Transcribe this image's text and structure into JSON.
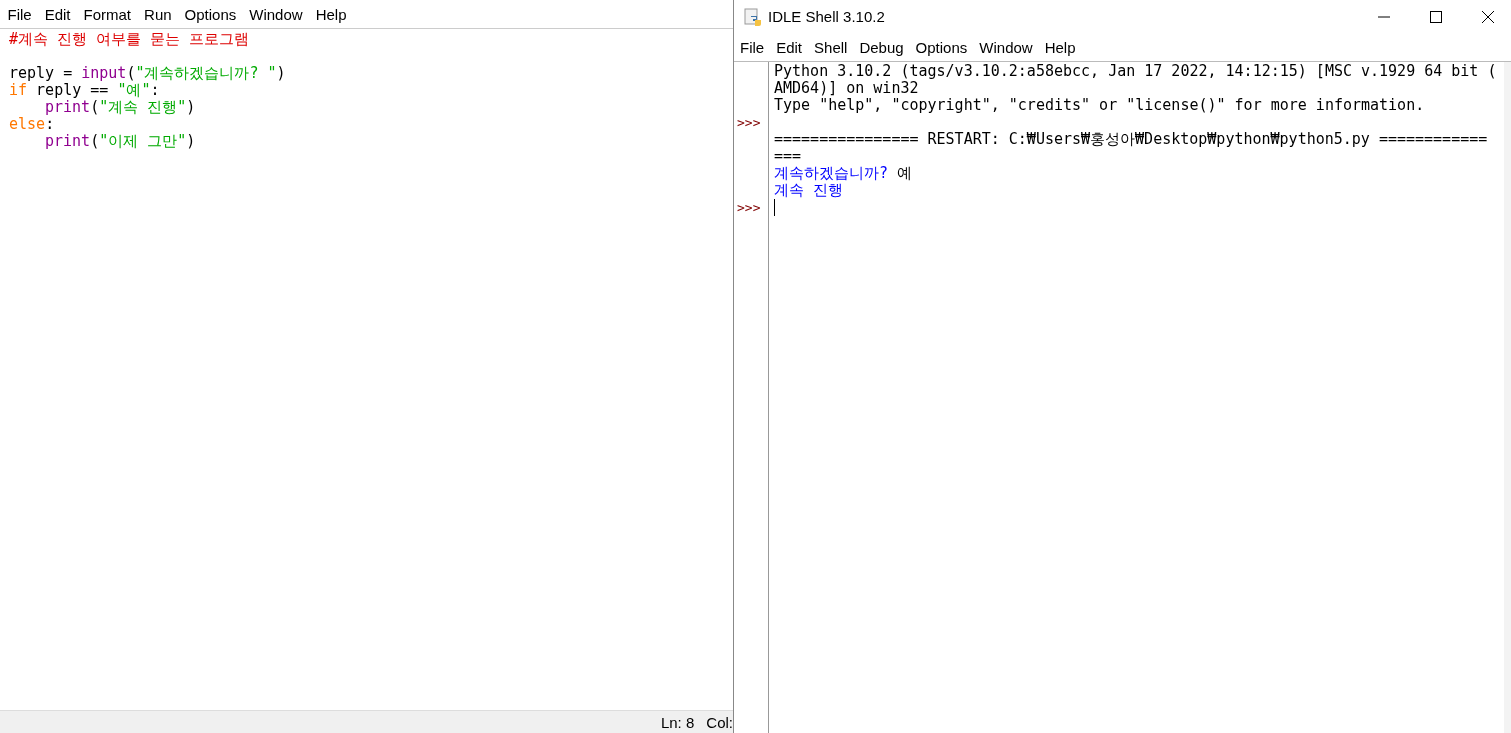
{
  "editor": {
    "menu": [
      "File",
      "Edit",
      "Format",
      "Run",
      "Options",
      "Window",
      "Help"
    ],
    "code_lines": [
      {
        "tokens": [
          {
            "kind": "comment",
            "text": "#계속 진행 여부를 묻는 프로그램"
          }
        ]
      },
      {
        "blank_before": true,
        "tokens": [
          {
            "kind": "plain",
            "text": "reply = "
          },
          {
            "kind": "builtin",
            "text": "input"
          },
          {
            "kind": "plain",
            "text": "("
          },
          {
            "kind": "string",
            "text": "\"계속하겠습니까? \""
          },
          {
            "kind": "plain",
            "text": ")"
          }
        ]
      },
      {
        "tokens": [
          {
            "kind": "keyword",
            "text": "if"
          },
          {
            "kind": "plain",
            "text": " reply == "
          },
          {
            "kind": "string",
            "text": "\"예\""
          },
          {
            "kind": "plain",
            "text": ":"
          }
        ]
      },
      {
        "indent": true,
        "tokens": [
          {
            "kind": "builtin",
            "text": "print"
          },
          {
            "kind": "plain",
            "text": "("
          },
          {
            "kind": "string",
            "text": "\"계속 진행\""
          },
          {
            "kind": "plain",
            "text": ")"
          }
        ]
      },
      {
        "tokens": [
          {
            "kind": "keyword",
            "text": "else"
          },
          {
            "kind": "plain",
            "text": ":"
          }
        ]
      },
      {
        "indent": true,
        "tokens": [
          {
            "kind": "builtin",
            "text": "print"
          },
          {
            "kind": "plain",
            "text": "("
          },
          {
            "kind": "string",
            "text": "\"이제 그만\""
          },
          {
            "kind": "plain",
            "text": ")"
          }
        ]
      }
    ],
    "status_bar": {
      "line": "Ln: 8",
      "column": "Col:"
    }
  },
  "shell": {
    "window": {
      "title": "IDLE Shell 3.10.2"
    },
    "menu": [
      "File",
      "Edit",
      "Shell",
      "Debug",
      "Options",
      "Window",
      "Help"
    ],
    "lines": [
      {
        "segments": [
          {
            "kind": "output",
            "text": "Python 3.10.2 (tags/v3.10.2:a58ebcc, Jan 17 2022, 14:12:15) [MSC v.1929 64 bit ("
          }
        ]
      },
      {
        "segments": [
          {
            "kind": "output",
            "text": "AMD64)] on win32"
          }
        ]
      },
      {
        "segments": [
          {
            "kind": "output",
            "text": "Type \"help\", \"copyright\", \"credits\" or \"license()\" for more information."
          }
        ]
      },
      {
        "prompt": ">>>"
      },
      {
        "segments": [
          {
            "kind": "output",
            "text": "================ RESTART: C:₩Users₩홍성아₩Desktop₩python₩python5.py ============"
          }
        ]
      },
      {
        "segments": [
          {
            "kind": "output",
            "text": "==="
          }
        ]
      },
      {
        "segments": [
          {
            "kind": "stdout",
            "text": "계속하겠습니까?"
          },
          {
            "kind": "stdin",
            "text": " 예"
          }
        ]
      },
      {
        "segments": [
          {
            "kind": "stdout",
            "text": "계속 진행"
          }
        ]
      },
      {
        "prompt": ">>>",
        "cursor": true
      }
    ]
  }
}
